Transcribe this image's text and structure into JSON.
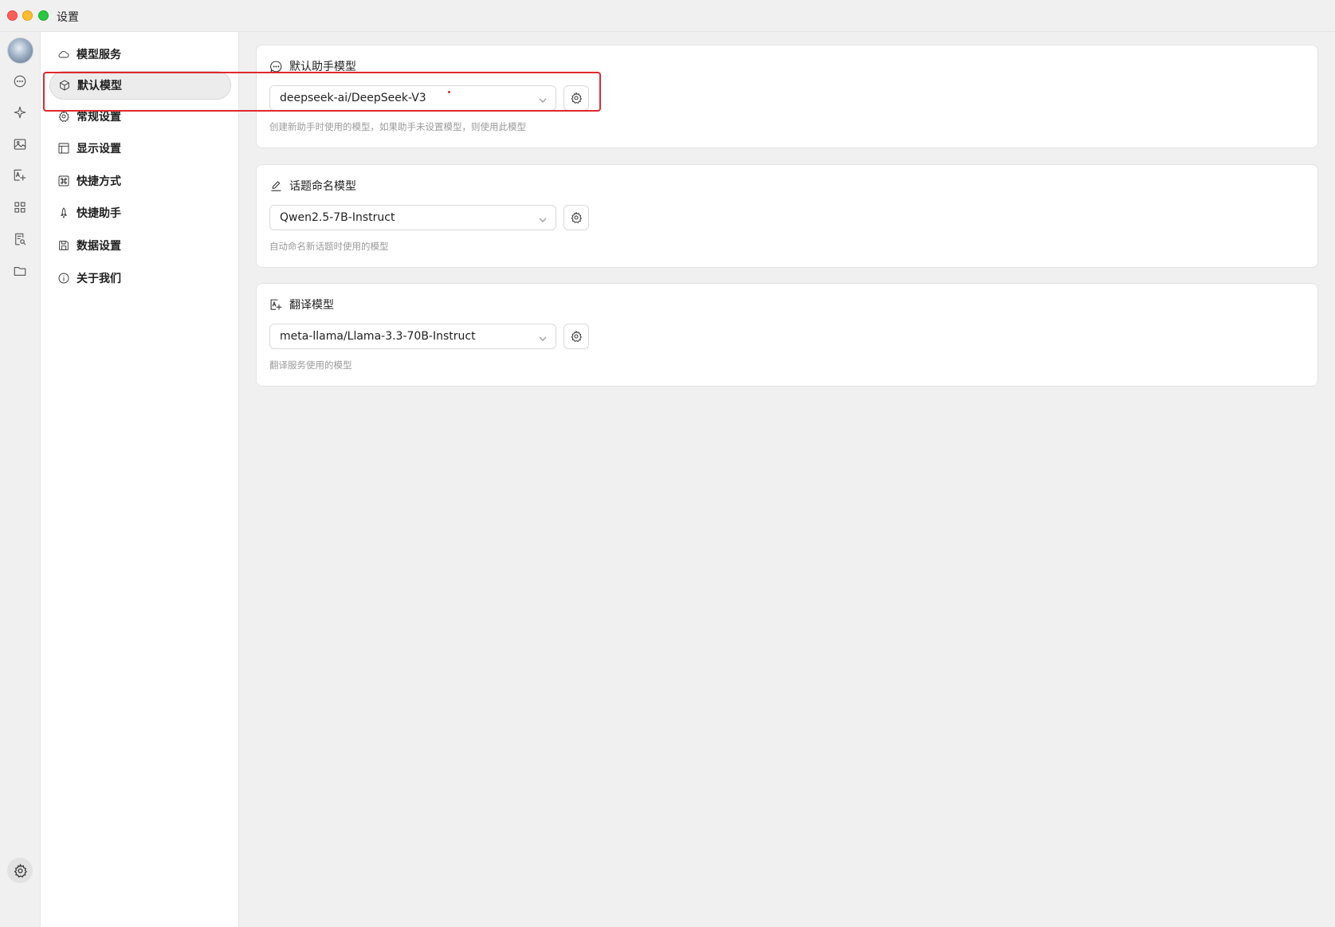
{
  "window": {
    "title": "设置"
  },
  "rail": {
    "icons": [
      "chat-icon",
      "sparkle-icon",
      "image-icon",
      "translate-icon",
      "apps-icon",
      "document-search-icon",
      "folder-icon",
      "sun-icon",
      "settings-icon"
    ]
  },
  "menu": {
    "items": [
      {
        "label": "模型服务",
        "icon": "cloud-icon"
      },
      {
        "label": "默认模型",
        "icon": "cube-icon",
        "active": true
      },
      {
        "label": "常规设置",
        "icon": "gear-icon"
      },
      {
        "label": "显示设置",
        "icon": "layout-icon"
      },
      {
        "label": "快捷方式",
        "icon": "command-icon"
      },
      {
        "label": "快捷助手",
        "icon": "rocket-icon"
      },
      {
        "label": "数据设置",
        "icon": "save-icon"
      },
      {
        "label": "关于我们",
        "icon": "info-icon"
      }
    ]
  },
  "cards": [
    {
      "title": "默认助手模型",
      "icon": "chat-bubble-icon",
      "value": "deepseek-ai/DeepSeek-V3",
      "description": "创建新助手时使用的模型，如果助手未设置模型，则使用此模型"
    },
    {
      "title": "话题命名模型",
      "icon": "edit-icon",
      "value": "Qwen2.5-7B-Instruct",
      "description": "自动命名新话题时使用的模型"
    },
    {
      "title": "翻译模型",
      "icon": "translate-icon",
      "value": "meta-llama/Llama-3.3-70B-Instruct",
      "description": "翻译服务使用的模型"
    }
  ],
  "colors": {
    "annotation": "#e0282e",
    "menu_active": "#ececec",
    "background": "#f0f0f0"
  }
}
